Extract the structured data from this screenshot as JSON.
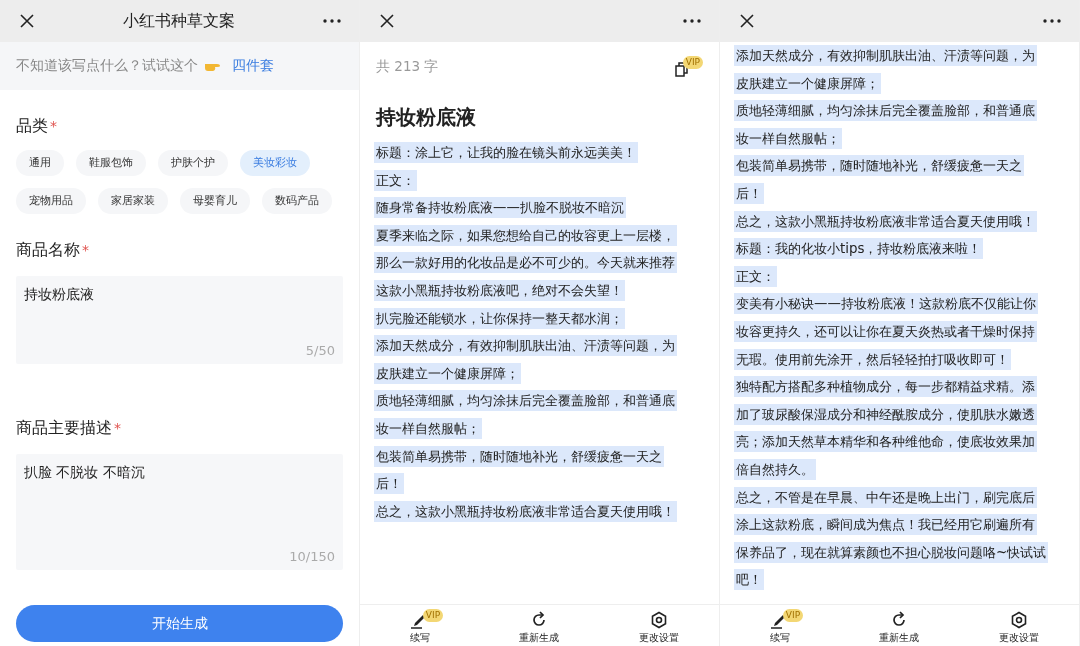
{
  "form_panel": {
    "header": {
      "title": "小红书种草文案"
    },
    "hint": {
      "text": "不知道该写点什么？试试这个",
      "link": "四件套"
    },
    "category": {
      "label": "品类",
      "required_mark": "*",
      "options": [
        {
          "label": "通用",
          "selected": false
        },
        {
          "label": "鞋服包饰",
          "selected": false
        },
        {
          "label": "护肤个护",
          "selected": false
        },
        {
          "label": "美妆彩妆",
          "selected": true
        },
        {
          "label": "宠物用品",
          "selected": false
        },
        {
          "label": "家居家装",
          "selected": false
        },
        {
          "label": "母婴育儿",
          "selected": false
        },
        {
          "label": "数码产品",
          "selected": false
        }
      ]
    },
    "fields": [
      {
        "label": "商品名称",
        "required_mark": "*",
        "value": "持妆粉底液",
        "counter": "5/50"
      },
      {
        "label": "商品主要描述",
        "required_mark": "*",
        "value": "扒脸 不脱妆 不暗沉",
        "counter": "10/150"
      }
    ],
    "submit_button": "开始生成"
  },
  "result_panel": {
    "word_count": "共 213 字",
    "copy_badge": "VIP",
    "title": "持妆粉底液",
    "lines": [
      "标题：涂上它，让我的脸在镜头前永远美美！",
      "正文：",
      "随身常备持妆粉底液——扒脸不脱妆不暗沉",
      "夏季来临之际，如果您想给自己的妆容更上一层楼，",
      "那么一款好用的化妆品是必不可少的。今天就来推荐",
      "这款小黑瓶持妆粉底液吧，绝对不会失望！",
      "扒完脸还能锁水，让你保持一整天都水润；",
      "添加天然成分，有效抑制肌肤出油、汗渍等问题，为",
      "皮肤建立一个健康屏障；",
      "质地轻薄细腻，均匀涂抹后完全覆盖脸部，和普通底",
      "妆一样自然服帖；",
      "包装简单易携带，随时随地补光，舒缓疲惫一天之",
      "后！",
      "总之，这款小黑瓶持妆粉底液非常适合夏天使用哦！"
    ],
    "toolbar": [
      {
        "kind": "pen",
        "label": "续写",
        "badge": "VIP"
      },
      {
        "kind": "refresh",
        "label": "重新生成"
      },
      {
        "kind": "settings",
        "label": "更改设置"
      }
    ]
  },
  "scrolled_panel": {
    "lines": [
      "添加天然成分，有效抑制肌肤出油、汗渍等问题，为",
      "皮肤建立一个健康屏障；",
      "质地轻薄细腻，均匀涂抹后完全覆盖脸部，和普通底",
      "妆一样自然服帖；",
      "包装简单易携带，随时随地补光，舒缓疲惫一天之",
      "后！",
      "总之，这款小黑瓶持妆粉底液非常适合夏天使用哦！",
      "标题：我的化妆小tips，持妆粉底液来啦！",
      "正文：",
      "变美有小秘诀——持妆粉底液！这款粉底不仅能让你",
      "妆容更持久，还可以让你在夏天炎热或者干燥时保持",
      "无瑕。使用前先涂开，然后轻轻拍打吸收即可！",
      "独特配方搭配多种植物成分，每一步都精益求精。添",
      "加了玻尿酸保湿成分和神经酰胺成分，使肌肤水嫩透",
      "亮；添加天然草本精华和各种维他命，使底妆效果加",
      "倍自然持久。",
      "总之，不管是在早晨、中午还是晚上出门，刷完底后",
      "涂上这款粉底，瞬间成为焦点！我已经用它刷遍所有",
      "保养品了，现在就算素颜也不担心脱妆问题咯~快试试",
      "吧！"
    ],
    "toolbar": [
      {
        "kind": "pen",
        "label": "续写",
        "badge": "VIP"
      },
      {
        "kind": "refresh",
        "label": "重新生成"
      },
      {
        "kind": "settings",
        "label": "更改设置"
      }
    ]
  }
}
